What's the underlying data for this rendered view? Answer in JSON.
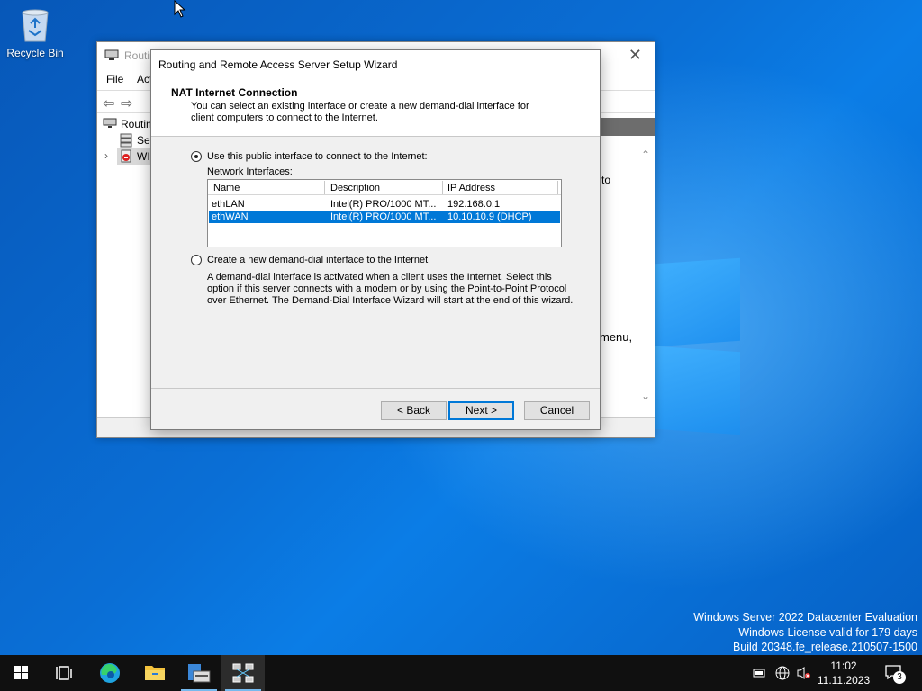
{
  "desktop": {
    "recycle_bin_label": "Recycle Bin",
    "watermark": {
      "line1": "Windows Server 2022 Datacenter Evaluation",
      "line2": "Windows License valid for 179 days",
      "line3": "Build 20348.fe_release.210507-1500"
    }
  },
  "mmc": {
    "title_partial": "Routin",
    "menu": {
      "file": "File",
      "action_partial": "Act"
    },
    "tree": {
      "root_partial": "Routin",
      "server_partial": "Ser",
      "node_partial": "WI"
    },
    "right_text": {
      "to": "to",
      "menu": "menu,"
    }
  },
  "wizard": {
    "title": "Routing and Remote Access Server Setup Wizard",
    "header_title": "NAT Internet Connection",
    "header_desc": "You can select an existing interface or create a new demand-dial interface for client computers to connect to the Internet.",
    "option1_label": "Use this public interface to connect to the Internet:",
    "network_interfaces_label": "Network Interfaces:",
    "columns": [
      "Name",
      "Description",
      "IP Address"
    ],
    "rows": [
      {
        "name": "ethLAN",
        "description": "Intel(R) PRO/1000 MT...",
        "ip": "192.168.0.1",
        "selected": false
      },
      {
        "name": "ethWAN",
        "description": "Intel(R) PRO/1000 MT...",
        "ip": "10.10.10.9 (DHCP)",
        "selected": true
      }
    ],
    "option2_label": "Create a new demand-dial interface to the Internet",
    "option2_desc": "A demand-dial interface is activated when a client uses the Internet. Select this option if this server connects with a modem or by using the Point-to-Point Protocol over Ethernet. The Demand-Dial Interface Wizard will start at the end of this wizard.",
    "selected_option": 1,
    "buttons": {
      "back": "< Back",
      "next": "Next >",
      "cancel": "Cancel"
    }
  },
  "taskbar": {
    "clock_time": "11:02",
    "clock_date": "11.11.2023",
    "notification_count": "3"
  },
  "colors": {
    "selection": "#0078d7",
    "taskbar": "#101010",
    "desktop": "#0a6fd6"
  }
}
